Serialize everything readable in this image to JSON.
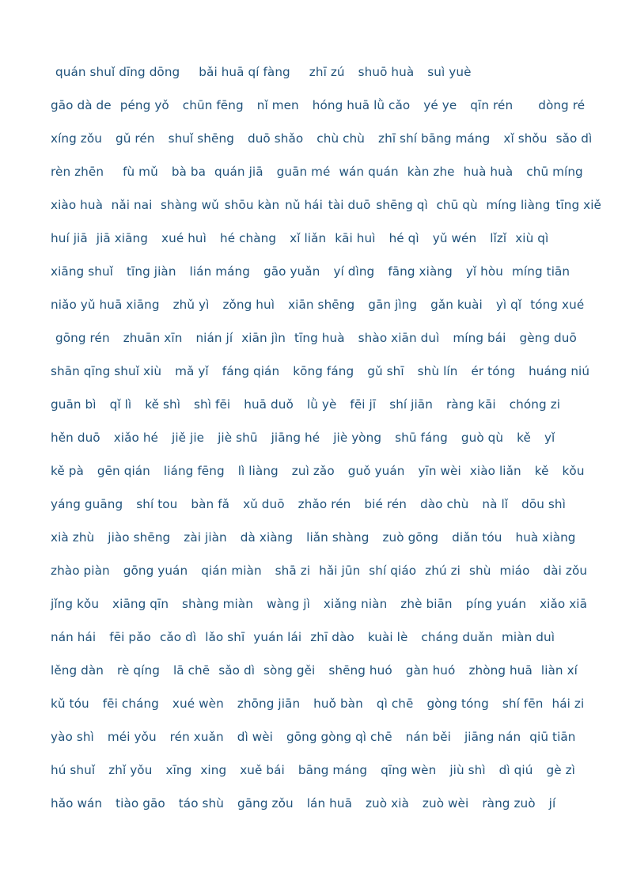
{
  "document": {
    "type": "pinyin-worksheet",
    "text_color": "#20527a",
    "background_color": "#ffffff",
    "rows": [
      {
        "indent": true,
        "items": [
          "quán shuǐ dīng dōng",
          "bǎi huā qí fàng",
          "zhī zú",
          "shuō huà",
          "suì yuè"
        ],
        "gaps": [
          "l",
          "l",
          "m",
          "m"
        ]
      },
      {
        "indent": false,
        "items": [
          "gāo dà de",
          "péng yǒ",
          "chūn fēng",
          "nǐ men",
          "hóng huā lǜ cǎo",
          "yé ye",
          "qīn rén",
          "dòng ré"
        ],
        "gaps": [
          "s",
          "m",
          "m",
          "m",
          "m",
          "m",
          "xl"
        ]
      },
      {
        "indent": false,
        "items": [
          "xíng zǒu",
          "gǔ rén",
          "shuǐ shēng",
          "duō shǎo",
          "chù chù",
          "zhī shí bāng máng",
          "xǐ shǒu",
          "sǎo dì"
        ],
        "gaps": [
          "m",
          "m",
          "m",
          "m",
          "m",
          "m",
          "s"
        ]
      },
      {
        "indent": false,
        "items": [
          "rèn zhēn",
          "fù mǔ",
          "bà ba",
          "quán jiā",
          "guān mé",
          "wán quán",
          "kàn zhe",
          "huà huà",
          "chū míng"
        ],
        "gaps": [
          "l",
          "m",
          "s",
          "m",
          "s",
          "s",
          "s",
          "m"
        ]
      },
      {
        "indent": false,
        "items": [
          "xiào huà",
          "nǎi nai",
          "shàng wǔ",
          "shōu kàn",
          "nǔ hái",
          "tài duō",
          "shēng qì",
          "chū qù",
          "míng liàng",
          "tīng xiě"
        ],
        "gaps": [
          "m",
          "m",
          "s",
          "s",
          "s",
          "s",
          "m",
          "m",
          "s"
        ]
      },
      {
        "indent": false,
        "items": [
          "huí jiā",
          "jiā xiāng",
          "xué huì",
          "hé chàng",
          "xǐ liǎn",
          "kāi huì",
          "hé qì",
          "yǔ wén",
          "lǐzǐ",
          "xiù qì"
        ],
        "gaps": [
          "s",
          "m",
          "m",
          "m",
          "s",
          "m",
          "m",
          "m",
          "s"
        ]
      },
      {
        "indent": false,
        "items": [
          "xiāng shuǐ",
          "tīng jiàn",
          "lián máng",
          "gāo yuǎn",
          "yí dìng",
          "fāng xiàng",
          "yǐ hòu",
          "míng tiān"
        ],
        "gaps": [
          "m",
          "m",
          "m",
          "m",
          "m",
          "m",
          "s"
        ]
      },
      {
        "indent": false,
        "items": [
          "niǎo yǔ huā xiāng",
          "zhǔ yì",
          "zǒng huì",
          "xiān shēng",
          "gān jìng",
          "gǎn kuài",
          "yì qǐ",
          "tóng xué"
        ],
        "gaps": [
          "m",
          "m",
          "m",
          "m",
          "m",
          "m",
          "s"
        ]
      },
      {
        "indent": true,
        "items": [
          "gōng rén",
          "zhuān xīn",
          "nián jí",
          "xiān jìn",
          "tīng huà",
          "shào xiān duì",
          "míng bái",
          "gèng duō"
        ],
        "gaps": [
          "m",
          "m",
          "s",
          "s",
          "m",
          "m",
          "m"
        ]
      },
      {
        "indent": false,
        "items": [
          "shān qīng shuǐ xiù",
          "mǎ yǐ",
          "fáng qián",
          "kōng fáng",
          "gǔ shī",
          "shù lín",
          "ér tóng",
          "huáng niú"
        ],
        "gaps": [
          "m",
          "m",
          "m",
          "m",
          "m",
          "m",
          "m"
        ]
      },
      {
        "indent": false,
        "items": [
          "guān bì",
          "qǐ lì",
          "kě shì",
          "shì fēi",
          "huā duǒ",
          "lǜ yè",
          "fēi jī",
          "shí jiān",
          "ràng kāi",
          "chóng zi"
        ],
        "gaps": [
          "m",
          "m",
          "m",
          "m",
          "m",
          "m",
          "m",
          "m",
          "m"
        ]
      },
      {
        "indent": false,
        "items": [
          "hěn duō",
          "xiǎo hé",
          "jiě jie",
          "jiè shū",
          "jiāng hé",
          "jiè yòng",
          "shū fáng",
          "guò qù",
          "kě",
          "yǐ"
        ],
        "gaps": [
          "m",
          "m",
          "m",
          "m",
          "m",
          "m",
          "m",
          "m",
          "m"
        ]
      },
      {
        "indent": false,
        "items": [
          "kě pà",
          "gēn qián",
          "liáng fēng",
          "lì liàng",
          "zuì zǎo",
          "guǒ yuán",
          "yīn wèi",
          "xiào liǎn",
          "kě",
          "kǒu"
        ],
        "gaps": [
          "m",
          "m",
          "m",
          "m",
          "m",
          "m",
          "s",
          "m",
          "m"
        ]
      },
      {
        "indent": false,
        "items": [
          "yáng guāng",
          "shí tou",
          "bàn fǎ",
          "xǔ duō",
          "zhǎo rén",
          "bié rén",
          "dào chù",
          "nà lǐ",
          "dōu shì"
        ],
        "gaps": [
          "m",
          "m",
          "m",
          "m",
          "m",
          "m",
          "m",
          "m"
        ]
      },
      {
        "indent": false,
        "items": [
          "xià zhù",
          "jiào shēng",
          "zài jiàn",
          "dà xiàng",
          "liǎn shàng",
          "zuò gōng",
          "diǎn tóu",
          "huà xiàng"
        ],
        "gaps": [
          "m",
          "m",
          "m",
          "m",
          "m",
          "m",
          "m"
        ]
      },
      {
        "indent": false,
        "items": [
          "zhào piàn",
          "gōng yuán",
          "qián miàn",
          "shā zi",
          "hǎi jūn",
          "shí qiáo",
          "zhú zi",
          "shù",
          "miáo",
          "dài zǒu"
        ],
        "gaps": [
          "m",
          "m",
          "m",
          "s",
          "s",
          "s",
          "s",
          "s",
          "m"
        ]
      },
      {
        "indent": false,
        "items": [
          "jǐng kǒu",
          "xiāng qīn",
          "shàng miàn",
          "wàng jì",
          "xiǎng niàn",
          "zhè biān",
          "píng yuán",
          "xiǎo xiā"
        ],
        "gaps": [
          "m",
          "m",
          "m",
          "m",
          "m",
          "m",
          "m"
        ]
      },
      {
        "indent": false,
        "items": [
          "nán hái",
          "fēi pǎo",
          "cǎo dì",
          "lǎo shī",
          "yuán lái",
          "zhī dào",
          "kuài lè",
          "cháng duǎn",
          "miàn duì"
        ],
        "gaps": [
          "m",
          "s",
          "s",
          "s",
          "s",
          "m",
          "m",
          "s"
        ]
      },
      {
        "indent": false,
        "items": [
          "lěng dàn",
          "rè qíng",
          "lā chē",
          "sǎo dì",
          "sòng gěi",
          "shēng huó",
          "gàn huó",
          "zhòng huā",
          "liàn xí"
        ],
        "gaps": [
          "m",
          "m",
          "s",
          "s",
          "m",
          "m",
          "m",
          "s"
        ]
      },
      {
        "indent": false,
        "items": [
          "kǔ tóu",
          "fēi cháng",
          "xué wèn",
          "zhōng jiān",
          "huǒ bàn",
          "qì chē",
          "gòng tóng",
          "shí fēn",
          "hái zi"
        ],
        "gaps": [
          "m",
          "m",
          "m",
          "m",
          "m",
          "m",
          "m",
          "s"
        ]
      },
      {
        "indent": false,
        "items": [
          "yào shì",
          "méi yǒu",
          "rén xuǎn",
          "dì wèi",
          "gōng gòng qì chē",
          "nán běi",
          "jiāng nán",
          "qiū tiān"
        ],
        "gaps": [
          "m",
          "m",
          "m",
          "m",
          "m",
          "m",
          "s"
        ]
      },
      {
        "indent": false,
        "items": [
          "hú shuǐ",
          "zhǐ yǒu",
          "xīng",
          "xing",
          "xuě bái",
          "bāng máng",
          "qīng wèn",
          "jiù shì",
          "dì qiú",
          "gè zì"
        ],
        "gaps": [
          "m",
          "m",
          "s",
          "m",
          "m",
          "m",
          "m",
          "m",
          "m"
        ]
      },
      {
        "indent": false,
        "items": [
          "hǎo wán",
          "tiào gāo",
          "táo shù",
          "gāng zǒu",
          "lán huā",
          "zuò xià",
          "zuò wèi",
          "ràng zuò",
          "jí"
        ],
        "gaps": [
          "m",
          "m",
          "m",
          "m",
          "m",
          "m",
          "m",
          "m"
        ]
      }
    ]
  }
}
